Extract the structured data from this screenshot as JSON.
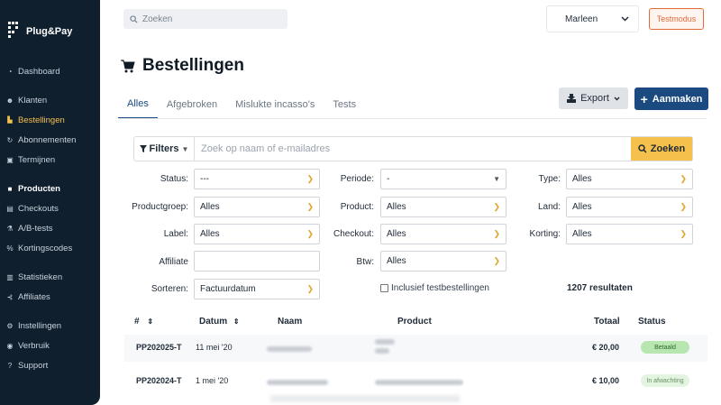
{
  "sidebar": {
    "logo": "Plug&Pay",
    "items": [
      {
        "label": "Dashboard",
        "icon": "dashboard-icon",
        "glyph": "◔"
      },
      {
        "label": "Klanten",
        "icon": "users-icon",
        "glyph": "☻"
      },
      {
        "label": "Bestellingen",
        "icon": "cart-icon",
        "glyph": "🛒"
      },
      {
        "label": "Abonnementen",
        "icon": "refresh-icon",
        "glyph": "↻"
      },
      {
        "label": "Termijnen",
        "icon": "calendar-icon",
        "glyph": "▣"
      },
      {
        "label": "Producten",
        "icon": "box-icon",
        "glyph": "■"
      },
      {
        "label": "Checkouts",
        "icon": "checkout-icon",
        "glyph": "▤"
      },
      {
        "label": "A/B-tests",
        "icon": "ab-icon",
        "glyph": "⚗"
      },
      {
        "label": "Kortingscodes",
        "icon": "percent-icon",
        "glyph": "%"
      },
      {
        "label": "Statistieken",
        "icon": "chart-icon",
        "glyph": "▥"
      },
      {
        "label": "Affiliates",
        "icon": "affiliate-icon",
        "glyph": "⊰"
      },
      {
        "label": "Instellingen",
        "icon": "gear-icon",
        "glyph": "⚙"
      },
      {
        "label": "Verbruik",
        "icon": "usage-icon",
        "glyph": "◉"
      },
      {
        "label": "Support",
        "icon": "question-icon",
        "glyph": "?"
      }
    ]
  },
  "topbar": {
    "search_placeholder": "Zoeken",
    "user_name": "Marleen",
    "test_mode_label": "Testmodus"
  },
  "page": {
    "title": "Bestellingen",
    "tabs": [
      "Alles",
      "Afgebroken",
      "Mislukte incasso's",
      "Tests"
    ],
    "export_label": "Export",
    "create_label": "Aanmaken"
  },
  "filters": {
    "filters_label": "Filters",
    "search_placeholder": "Zoek op naam of e-mailadres",
    "search_button": "Zoeken",
    "fields": {
      "status": {
        "label": "Status:",
        "value": "---"
      },
      "productgroep": {
        "label": "Productgroep:",
        "value": "Alles"
      },
      "label": {
        "label": "Label:",
        "value": "Alles"
      },
      "affiliate": {
        "label": "Affiliate",
        "value": ""
      },
      "sorteren": {
        "label": "Sorteren:",
        "value": "Factuurdatum"
      },
      "periode": {
        "label": "Periode:",
        "value": "-"
      },
      "product": {
        "label": "Product:",
        "value": "Alles"
      },
      "checkout": {
        "label": "Checkout:",
        "value": "Alles"
      },
      "btw": {
        "label": "Btw:",
        "value": "Alles"
      },
      "type": {
        "label": "Type:",
        "value": "Alles"
      },
      "land": {
        "label": "Land:",
        "value": "Alles"
      },
      "korting": {
        "label": "Korting:",
        "value": "Alles"
      }
    },
    "include_tests_label": "Inclusief testbestellingen",
    "results": "1207 resultaten"
  },
  "table": {
    "headers": {
      "number": "#",
      "date": "Datum",
      "name": "Naam",
      "product": "Product",
      "total": "Totaal",
      "status": "Status"
    },
    "rows": [
      {
        "number": "PP202025-T",
        "date": "11 mei '20",
        "total": "€ 20,00",
        "status": "Betaald"
      },
      {
        "number": "PP202024-T",
        "date": "1 mei '20",
        "total": "€ 10,00",
        "status": "In afwachting"
      }
    ]
  },
  "colors": {
    "sidebar_bg": "#0f1f2e",
    "accent_blue": "#1a4a80",
    "accent_yellow": "#f6c04d",
    "test_orange": "#e26a3a",
    "active_nav": "#f5c04a"
  }
}
